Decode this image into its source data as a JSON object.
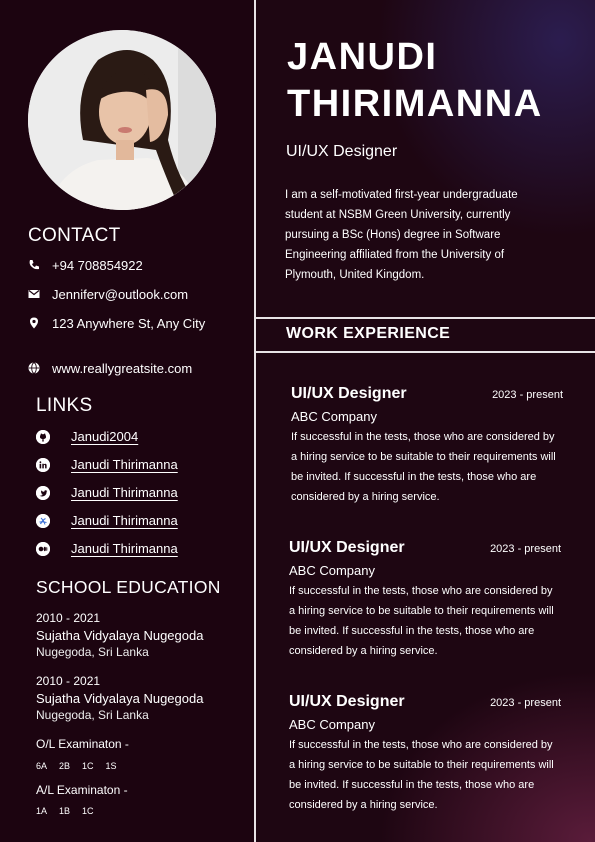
{
  "name_line1": "JANUDI",
  "name_line2": "THIRIMANNA",
  "role": "UI/UX Designer",
  "about": "I am a self-motivated first-year undergraduate student at NSBM Green University, currently pursuing a BSc (Hons) degree in Software Engineering affiliated from the University of Plymouth, United Kingdom.",
  "contact": {
    "title": "CONTACT",
    "phone": "+94 708854922",
    "email": "Jenniferv@outlook.com",
    "address": "123 Anywhere St, Any City",
    "website": "www.reallygreatsite.com"
  },
  "links": {
    "title": "LINKS",
    "items": [
      {
        "icon": "github-icon",
        "label": "Janudi2004"
      },
      {
        "icon": "linkedin-icon",
        "label": "Janudi Thirimanna"
      },
      {
        "icon": "twitter-icon",
        "label": "Janudi Thirimanna"
      },
      {
        "icon": "dribbble-icon",
        "label": "Janudi Thirimanna"
      },
      {
        "icon": "medium-icon",
        "label": "Janudi Thirimanna"
      }
    ]
  },
  "education": {
    "title": "SCHOOL EDUCATION",
    "entries": [
      {
        "years": "2010 - 2021",
        "school": "Sujatha Vidyalaya Nugegoda",
        "location": "Nugegoda, Sri Lanka"
      },
      {
        "years": "2010 - 2021",
        "school": "Sujatha Vidyalaya Nugegoda",
        "location": "Nugegoda, Sri Lanka"
      }
    ],
    "ol_title": "O/L Examinaton -",
    "ol_grades": [
      "6A",
      "2B",
      "1C",
      "1S"
    ],
    "al_title": "A/L Examinaton -",
    "al_grades": [
      "1A",
      "1B",
      "1C"
    ]
  },
  "work": {
    "title": "WORK EXPERIENCE",
    "jobs": [
      {
        "title": "UI/UX Designer",
        "date": "2023 - present",
        "company": "ABC Company",
        "desc": "If successful in the tests, those who are considered by a hiring service to be suitable to their requirements will be invited. If successful in the tests, those who are considered by a hiring service."
      },
      {
        "title": "UI/UX Designer",
        "date": "2023 - present",
        "company": "ABC Company",
        "desc": "If successful in the tests, those who are considered by a hiring service to be suitable to their requirements will be invited. If successful in the tests, those who are considered by a hiring service."
      },
      {
        "title": "UI/UX Designer",
        "date": "2023 - present",
        "company": "ABC Company",
        "desc": "If successful in the tests, those who are considered by a hiring service to be suitable to their requirements will be invited. If successful in the tests, those who are considered by a hiring service."
      }
    ]
  },
  "colors": {
    "background": "#1e0612",
    "sidebar": "#1c0410",
    "divider": "#e8e3e6",
    "text": "#ffffff"
  }
}
